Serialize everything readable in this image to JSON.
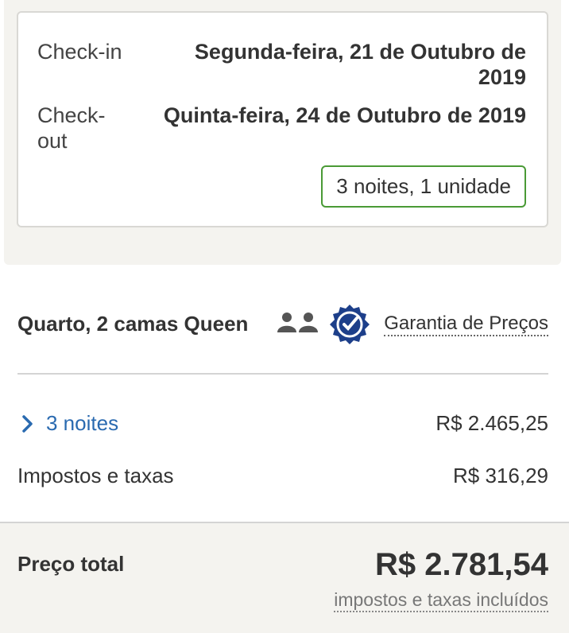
{
  "booking": {
    "checkin_label": "Check-in",
    "checkin_value_line1": "Segunda-feira, 21 de Outubro de",
    "checkin_value_line2": "2019",
    "checkout_label_line1": "Check-",
    "checkout_label_line2": "out",
    "checkout_value": "Quinta-feira, 24 de Outubro de 2019",
    "stay_summary": "3 noites, 1 unidade"
  },
  "room": {
    "name": "Quarto, 2 camas Queen",
    "guarantee_label": "Garantia de Preços",
    "icons": [
      "people-icon",
      "price-guarantee-badge-icon"
    ]
  },
  "pricing": {
    "nights_link": "3 noites",
    "nights_price": "R$ 2.465,25",
    "taxes_label": "Impostos e taxas",
    "taxes_price": "R$ 316,29",
    "total_label": "Preço total",
    "total_price": "R$ 2.781,54",
    "total_note": "impostos e taxas incluídos"
  },
  "colors": {
    "accent_green": "#4a9a36",
    "link_blue": "#2a6ab0",
    "badge_navy": "#1d3f8a",
    "panel_bg": "#f4f3ef"
  }
}
